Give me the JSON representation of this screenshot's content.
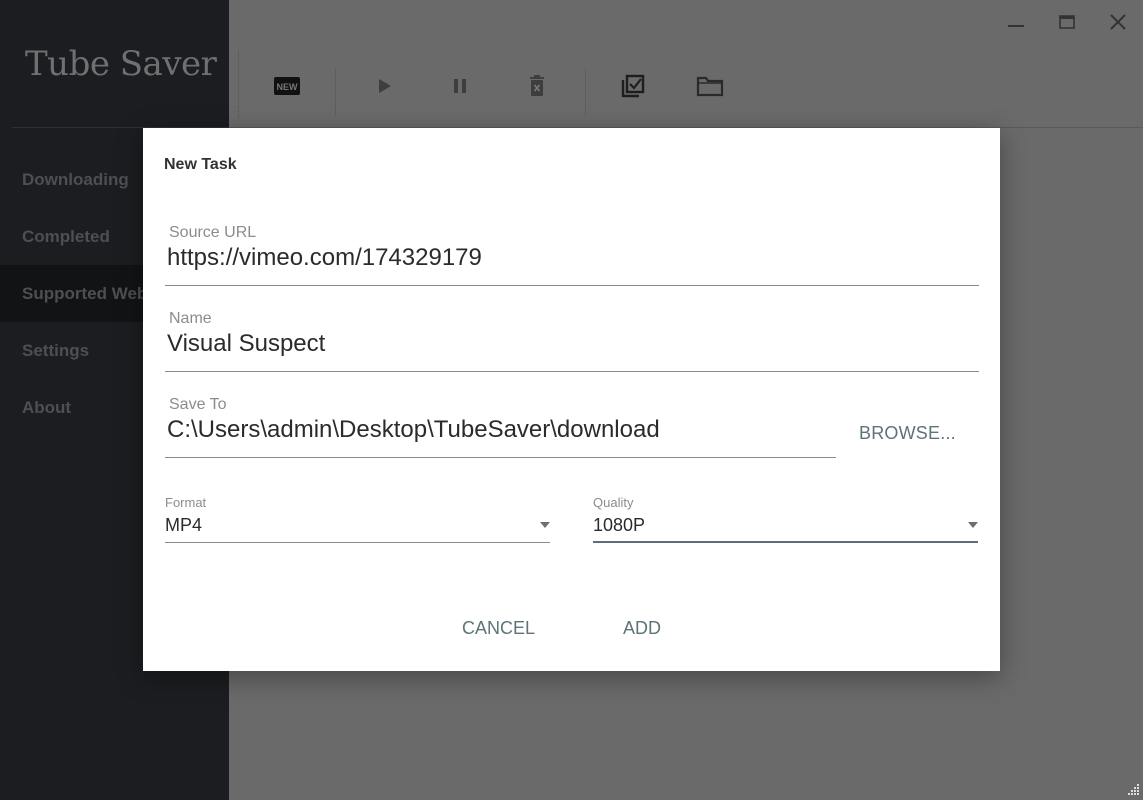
{
  "app": {
    "title": "Tube Saver"
  },
  "sidebar": {
    "items": [
      {
        "label": "Downloading",
        "active": false
      },
      {
        "label": "Completed",
        "active": false
      },
      {
        "label": "Supported Websites",
        "active": true
      },
      {
        "label": "Settings",
        "active": false
      },
      {
        "label": "About",
        "active": false
      }
    ]
  },
  "toolbar": {
    "buttons": [
      {
        "icon": "new-icon",
        "label": "NEW"
      },
      {
        "icon": "play-icon"
      },
      {
        "icon": "pause-icon"
      },
      {
        "icon": "delete-icon"
      },
      {
        "icon": "select-all-icon"
      },
      {
        "icon": "folder-icon"
      }
    ]
  },
  "window": {
    "controls": [
      "minimize-icon",
      "maximize-icon",
      "close-icon"
    ]
  },
  "dialog": {
    "title": "New Task",
    "source_url": {
      "label": "Source URL",
      "value": "https://vimeo.com/174329179"
    },
    "name": {
      "label": "Name",
      "value": "Visual Suspect"
    },
    "save_to": {
      "label": "Save To",
      "value": "C:\\Users\\admin\\Desktop\\TubeSaver\\download"
    },
    "browse_label": "BROWSE...",
    "format": {
      "label": "Format",
      "value": "MP4"
    },
    "quality": {
      "label": "Quality",
      "value": "1080P"
    },
    "cancel_label": "CANCEL",
    "add_label": "ADD"
  },
  "colors": {
    "accent": "#5f7378",
    "sidebar_bg": "#1b1d20",
    "overlay": "#6a6a6a"
  }
}
